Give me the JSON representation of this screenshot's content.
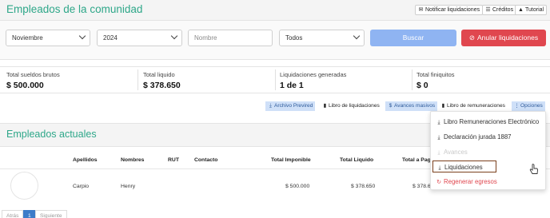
{
  "header": {
    "title": "Empleados de la comunidad",
    "buttons": [
      {
        "label": "Notificar liquidaciones",
        "icon": "envelope-icon"
      },
      {
        "label": "Créditos",
        "icon": "list-icon"
      },
      {
        "label": "Tutorial",
        "icon": "graduation-cap-icon"
      }
    ]
  },
  "filters": {
    "month": "Noviembre",
    "year": "2024",
    "name_placeholder": "Nombre",
    "status": "Todos",
    "search_label": "Buscar",
    "cancel_label": "Anular liquidaciones"
  },
  "stats": [
    {
      "label": "Total sueldos brutos",
      "value": "$ 500.000"
    },
    {
      "label": "Total liquido",
      "value": "$ 378.650"
    },
    {
      "label": "Liquidaciones generadas",
      "value": "1 de 1"
    },
    {
      "label": "Total finiquitos",
      "value": "$ 0"
    }
  ],
  "actions": {
    "archivo_previred": "Archivo Previred",
    "libro_liquidaciones": "Libro de liquidaciones",
    "avances_masivos": "Avances masivos",
    "libro_remuneraciones": "Libro de remuneraciones",
    "opciones": "Opciones"
  },
  "section": {
    "title": "Empleados actuales"
  },
  "table": {
    "headers": [
      "Apellidos",
      "Nombres",
      "RUT",
      "Contacto",
      "Total Imponible",
      "Total Liquido",
      "Total a Pag"
    ],
    "row": {
      "apellidos": "Carpio",
      "nombres": "Henry",
      "rut": "",
      "contacto": "",
      "imponible": "$ 500.000",
      "liquido": "$ 378.650",
      "pagar": "$ 378.65"
    }
  },
  "pagination": {
    "prev": "Atrás",
    "page": "1",
    "next": "Siguiente"
  },
  "menu": {
    "items": [
      {
        "label": "Libro Remuneraciones Electrónico",
        "icon": "download-icon"
      },
      {
        "label": "Declaración jurada 1887",
        "icon": "download-icon"
      },
      {
        "label": "Avances",
        "icon": "download-icon"
      },
      {
        "label": "Liquidaciones",
        "icon": "download-icon"
      },
      {
        "label": "Regenerar egresos",
        "icon": "refresh-icon"
      }
    ]
  },
  "colors": {
    "accent": "#2ea789",
    "danger": "#e0474f",
    "primary": "#3d7cc9"
  }
}
